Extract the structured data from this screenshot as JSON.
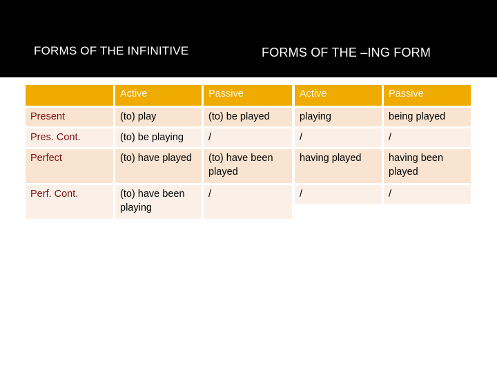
{
  "titles": {
    "infinitive": "FORMS OF THE INFINITIVE",
    "ing_form": "FORMS OF THE –ING FORM"
  },
  "colors": {
    "header_band": "#000000",
    "table_header": "#efab00",
    "row_odd": "#f8e4d0",
    "row_even": "#fbf0e8",
    "row_label_text": "#7b1010"
  },
  "infinitive_table": {
    "headers": [
      "",
      "Active",
      "Passive"
    ],
    "rows": [
      {
        "label": "Present",
        "active": "(to) play",
        "passive": "(to) be played"
      },
      {
        "label": "Pres. Cont.",
        "active": "(to) be playing",
        "passive": "/"
      },
      {
        "label": "Perfect",
        "active": "(to) have played",
        "passive": "(to) have been played"
      },
      {
        "label": "Perf. Cont.",
        "active": "(to) have been playing",
        "passive": "/"
      }
    ]
  },
  "ing_table": {
    "headers": [
      "Active",
      "Passive"
    ],
    "rows": [
      {
        "active": "playing",
        "passive": "being played"
      },
      {
        "active": "/",
        "passive": "/"
      },
      {
        "active": "having played",
        "passive": "having been played"
      },
      {
        "active": "/",
        "passive": "/"
      }
    ]
  }
}
